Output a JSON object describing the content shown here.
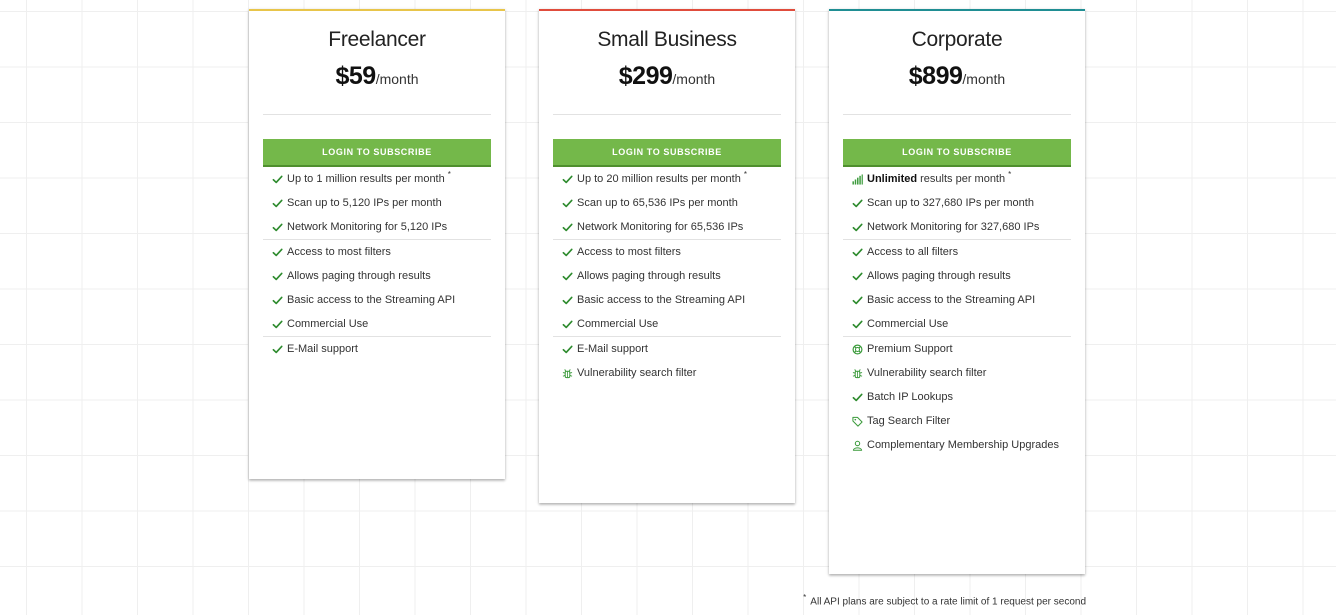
{
  "colors": {
    "accent_green": "#74b84a",
    "freelancer_top": "#e8c54a",
    "small_business_top": "#e04c3c",
    "corporate_top": "#1f8e93"
  },
  "plans": [
    {
      "name": "Freelancer",
      "price": "$59",
      "period": "/month",
      "button": "LOGIN TO SUBSCRIBE",
      "section1": [
        {
          "icon": "check-icon",
          "text": "Up to 1 million results per month",
          "asterisk": "*"
        },
        {
          "icon": "check-icon",
          "text": "Scan up to 5,120 IPs per month"
        },
        {
          "icon": "check-icon",
          "text": "Network Monitoring for 5,120 IPs"
        }
      ],
      "section2": [
        {
          "icon": "check-icon",
          "text": "Access to most filters"
        },
        {
          "icon": "check-icon",
          "text": "Allows paging through results"
        },
        {
          "icon": "check-icon",
          "text": "Basic access to the Streaming API"
        },
        {
          "icon": "check-icon",
          "text": "Commercial Use"
        }
      ],
      "section3": [
        {
          "icon": "check-icon",
          "text": "E-Mail support"
        }
      ]
    },
    {
      "name": "Small Business",
      "price": "$299",
      "period": "/month",
      "button": "LOGIN TO SUBSCRIBE",
      "section1": [
        {
          "icon": "check-icon",
          "text": "Up to 20 million results per month",
          "asterisk": "*"
        },
        {
          "icon": "check-icon",
          "text": "Scan up to 65,536 IPs per month"
        },
        {
          "icon": "check-icon",
          "text": "Network Monitoring for 65,536 IPs"
        }
      ],
      "section2": [
        {
          "icon": "check-icon",
          "text": "Access to most filters"
        },
        {
          "icon": "check-icon",
          "text": "Allows paging through results"
        },
        {
          "icon": "check-icon",
          "text": "Basic access to the Streaming API"
        },
        {
          "icon": "check-icon",
          "text": "Commercial Use"
        }
      ],
      "section3": [
        {
          "icon": "check-icon",
          "text": "E-Mail support"
        },
        {
          "icon": "bug-icon",
          "text": "Vulnerability search filter"
        }
      ]
    },
    {
      "name": "Corporate",
      "price": "$899",
      "period": "/month",
      "button": "LOGIN TO SUBSCRIBE",
      "section1": [
        {
          "icon": "signal-bars-icon",
          "bold": "Unlimited",
          "text": "results per month",
          "asterisk": "*"
        },
        {
          "icon": "check-icon",
          "text": "Scan up to 327,680 IPs per month"
        },
        {
          "icon": "check-icon",
          "text": "Network Monitoring for 327,680 IPs"
        }
      ],
      "section2": [
        {
          "icon": "check-icon",
          "text": "Access to all filters"
        },
        {
          "icon": "check-icon",
          "text": "Allows paging through results"
        },
        {
          "icon": "check-icon",
          "text": "Basic access to the Streaming API"
        },
        {
          "icon": "check-icon",
          "text": "Commercial Use"
        }
      ],
      "section3": [
        {
          "icon": "life-ring-icon",
          "text": "Premium Support"
        },
        {
          "icon": "bug-icon",
          "text": "Vulnerability search filter"
        },
        {
          "icon": "check-icon",
          "text": "Batch IP Lookups"
        },
        {
          "icon": "tag-icon",
          "text": "Tag Search Filter"
        },
        {
          "icon": "user-icon",
          "text": "Complementary Membership Upgrades"
        }
      ]
    }
  ],
  "footnote": {
    "asterisk": "*",
    "text": "All API plans are subject to a rate limit of 1 request per second"
  }
}
